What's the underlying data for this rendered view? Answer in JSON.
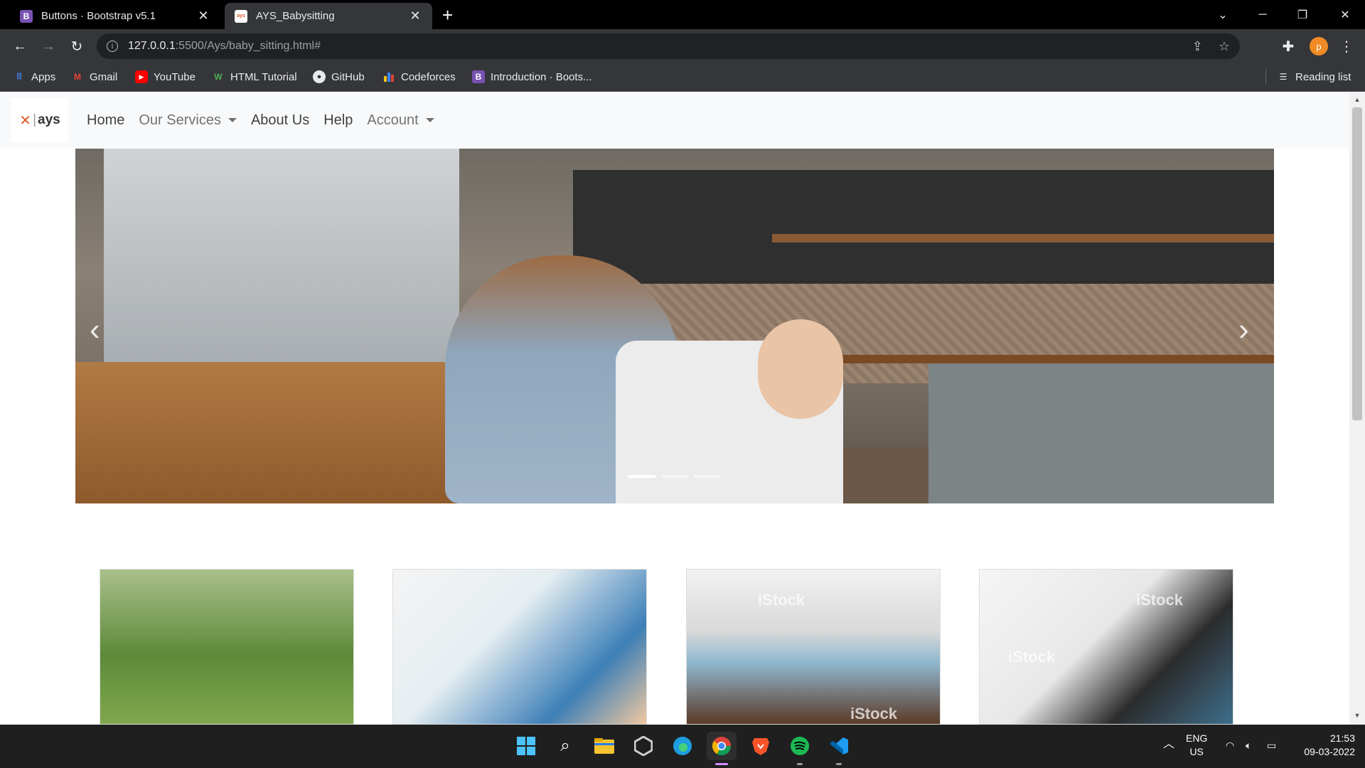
{
  "browser": {
    "tabs": [
      {
        "title": "Buttons · Bootstrap v5.1",
        "favicon": "bootstrap-icon",
        "active": false
      },
      {
        "title": "AYS_Babysitting",
        "favicon": "ays-favicon",
        "active": true
      }
    ],
    "address": {
      "host": "127.0.0.1",
      "rest": ":5500/Ays/baby_sitting.html#"
    },
    "profile_initial": "p",
    "bookmarks": [
      {
        "label": "Apps",
        "icon": "apps-grid-icon"
      },
      {
        "label": "Gmail",
        "icon": "gmail-icon"
      },
      {
        "label": "YouTube",
        "icon": "youtube-icon"
      },
      {
        "label": "HTML Tutorial",
        "icon": "w3schools-icon"
      },
      {
        "label": "GitHub",
        "icon": "github-icon"
      },
      {
        "label": "Codeforces",
        "icon": "codeforces-icon"
      },
      {
        "label": "Introduction · Boots...",
        "icon": "bootstrap-icon"
      }
    ],
    "reading_list": "Reading list"
  },
  "site": {
    "brand": "ays",
    "nav": [
      {
        "label": "Home",
        "dropdown": false
      },
      {
        "label": "Our Services",
        "dropdown": true
      },
      {
        "label": "About Us",
        "dropdown": false
      },
      {
        "label": "Help",
        "dropdown": false
      },
      {
        "label": "Account",
        "dropdown": true
      }
    ],
    "carousel": {
      "slides": 3,
      "active": 0
    },
    "cards": [
      {
        "image": "children-playing-on-grass"
      },
      {
        "image": "mother-feeding-baby"
      },
      {
        "image": "baby-in-hooded-towel",
        "watermark": "iStock"
      },
      {
        "image": "woman-reading-with-girl",
        "watermark": "iStock"
      }
    ]
  },
  "taskbar": {
    "apps": [
      "windows-start-icon",
      "search-icon",
      "file-explorer-icon",
      "unity-icon",
      "edge-icon",
      "chrome-icon",
      "brave-icon",
      "spotify-icon",
      "vscode-icon"
    ],
    "language": "ENG",
    "region": "US",
    "time": "21:53",
    "date": "09-03-2022"
  },
  "colors": {
    "accent": "#e05a2a",
    "navbar_bg": "#f8f9fa",
    "chrome_dark": "#35363a"
  }
}
